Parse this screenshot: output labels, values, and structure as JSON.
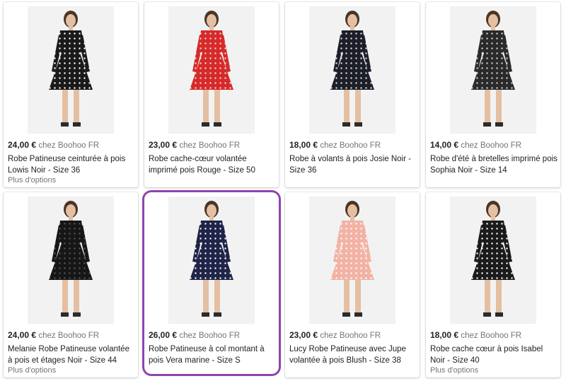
{
  "products": [
    {
      "price": "24,00 €",
      "merchant": "chez Boohoo FR",
      "title": "Robe Patineuse ceinturée à pois Lowis Noir - Size 36",
      "options": "Plus d'options",
      "dress_color": "#1a1a1a",
      "dot_color": "#ffffff",
      "image_icon": "black-polka-dot-wrap-dress"
    },
    {
      "price": "23,00 €",
      "merchant": "chez Boohoo FR",
      "title": "Robe cache-cœur volantée imprimé pois Rouge - Size 50",
      "options": "",
      "dress_color": "#d62a2a",
      "dot_color": "#f4d7d7",
      "image_icon": "red-ruffle-wrap-dress"
    },
    {
      "price": "18,00 €",
      "merchant": "chez Boohoo FR",
      "title": "Robe à volants à pois Josie Noir - Size 36",
      "options": "",
      "dress_color": "#1c1f2a",
      "dot_color": "#dddddd",
      "image_icon": "black-ruffle-wrap-dress"
    },
    {
      "price": "14,00 €",
      "merchant": "chez Boohoo FR",
      "title": "Robe d'été à bretelles imprimé pois Sophia Noir - Size 14",
      "options": "",
      "dress_color": "#2a2a2a",
      "dot_color": "#cfcfcf",
      "image_icon": "black-strappy-dot-dress"
    },
    {
      "price": "24,00 €",
      "merchant": "chez Boohoo FR",
      "title": "Melanie Robe Patineuse volantée à pois et étages Noir - Size 44",
      "options": "Plus d'options",
      "dress_color": "#161616",
      "dot_color": "#555555",
      "image_icon": "black-sheer-tiered-dress"
    },
    {
      "price": "26,00 €",
      "merchant": "chez Boohoo FR",
      "title": "Robe Patineuse à col montant à pois Vera marine - Size S",
      "options": "",
      "dress_color": "#1f2448",
      "dot_color": "#ffffff",
      "image_icon": "navy-high-neck-dot-dress"
    },
    {
      "price": "23,00 €",
      "merchant": "chez Boohoo FR",
      "title": "Lucy Robe Patineuse avec Jupe volantée à pois Blush - Size 38",
      "options": "",
      "dress_color": "#f2b3a4",
      "dot_color": "#ffffff",
      "image_icon": "blush-tiered-dress"
    },
    {
      "price": "18,00 €",
      "merchant": "chez Boohoo FR",
      "title": "Robe cache cœur à pois Isabel Noir - Size 40",
      "options": "Plus d'options",
      "dress_color": "#1b1b1b",
      "dot_color": "#ffffff",
      "image_icon": "black-mixed-dot-wrap-dress"
    }
  ],
  "accent": "#8e44ad"
}
